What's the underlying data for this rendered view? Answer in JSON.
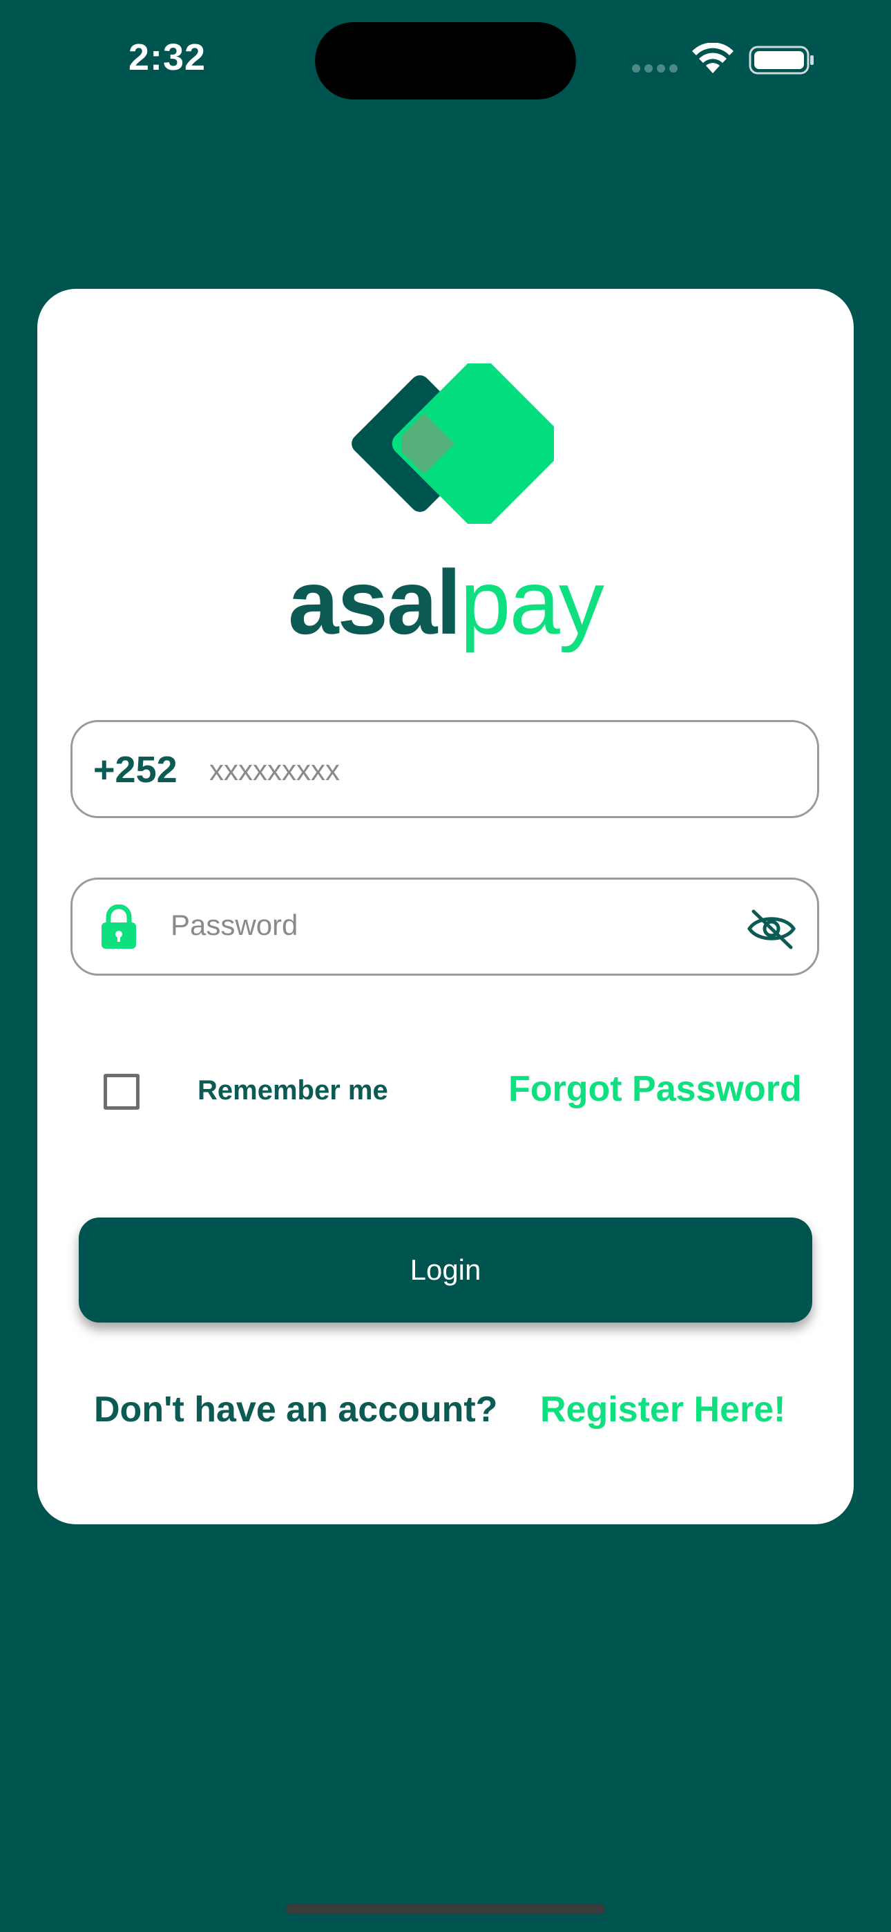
{
  "status_bar": {
    "time": "2:32"
  },
  "logo": {
    "text_part1": "asal",
    "text_part2": "pay"
  },
  "phone_field": {
    "country_code": "+252",
    "placeholder": "xxxxxxxxx"
  },
  "password_field": {
    "placeholder": "Password"
  },
  "remember": {
    "label": "Remember me",
    "checked": false
  },
  "forgot_password_label": "Forgot Password",
  "login_button_label": "Login",
  "register": {
    "prompt": "Don't have an account?",
    "link_label": "Register Here!"
  },
  "colors": {
    "background": "#005450",
    "card": "#ffffff",
    "brand_dark": "#0b5a53",
    "brand_green": "#0fe07f"
  },
  "icons": [
    "wifi-icon",
    "battery-icon",
    "lock-icon",
    "eye-off-icon"
  ]
}
